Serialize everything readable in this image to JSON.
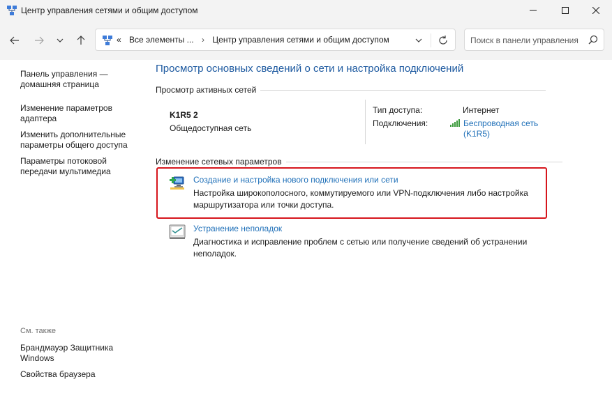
{
  "window": {
    "title": "Центр управления сетями и общим доступом"
  },
  "address": {
    "prefix": "«",
    "crumb1": "Все элементы ...",
    "separator": "›",
    "crumb2": "Центр управления сетями и общим доступом"
  },
  "search": {
    "placeholder": "Поиск в панели управления"
  },
  "sidebar": {
    "items": [
      {
        "label": "Панель управления — домашняя страница"
      },
      {
        "label": "Изменение параметров адаптера"
      },
      {
        "label": "Изменить дополнительные параметры общего доступа"
      },
      {
        "label": "Параметры потоковой передачи мультимедиа"
      }
    ],
    "see_also": "См. также",
    "see_also_items": [
      {
        "label": "Брандмауэр Защитника Windows"
      },
      {
        "label": "Свойства браузера"
      }
    ]
  },
  "main": {
    "title": "Просмотр основных сведений о сети и настройка подключений",
    "active_networks_heading": "Просмотр активных сетей",
    "network": {
      "name": "K1R5 2",
      "type": "Общедоступная сеть",
      "access_label": "Тип доступа:",
      "access_value": "Интернет",
      "connections_label": "Подключения:",
      "connection_link": "Беспроводная сеть (K1R5)"
    },
    "change_heading": "Изменение сетевых параметров",
    "tasks": [
      {
        "link": "Создание и настройка нового подключения или сети",
        "description": "Настройка широкополосного, коммутируемого или VPN-подключения либо настройка маршрутизатора или точки доступа."
      },
      {
        "link": "Устранение неполадок",
        "description": "Диагностика и исправление проблем с сетью или получение сведений об устранении неполадок."
      }
    ]
  },
  "colors": {
    "link": "#1e6fb8",
    "title": "#1e5aa0",
    "highlight": "#d6151c"
  }
}
